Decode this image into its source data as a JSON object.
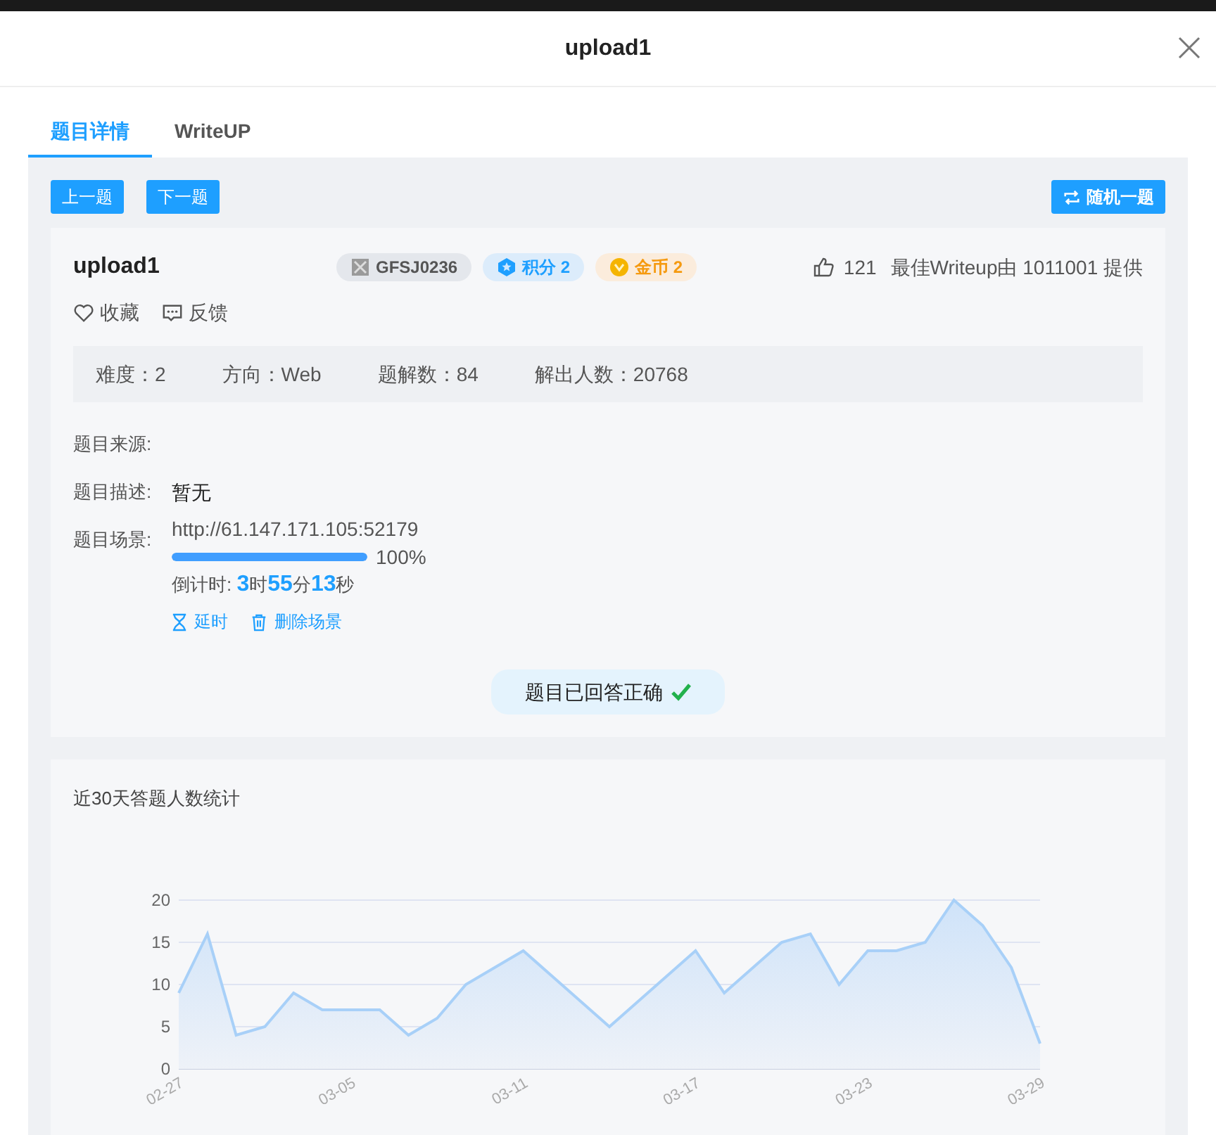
{
  "modal": {
    "title": "upload1"
  },
  "tabs": [
    {
      "label": "题目详情",
      "selected": true
    },
    {
      "label": "WriteUP",
      "selected": false
    }
  ],
  "nav_buttons": {
    "prev": "上一题",
    "next": "下一题",
    "random": "随机一题"
  },
  "challenge": {
    "name": "upload1",
    "badges": [
      {
        "kind": "id",
        "label": "GFSJ0236"
      },
      {
        "kind": "score",
        "label": "积分 2"
      },
      {
        "kind": "coin",
        "label": "金币 2"
      }
    ],
    "likes": "121",
    "best_writeup": "最佳Writeup由 1011001 提供",
    "actions": [
      "收藏",
      "反馈"
    ],
    "stats": [
      "难度：2",
      "方向：Web",
      "题解数：84",
      "解出人数：20768"
    ],
    "source_label": "题目来源:",
    "description_label": "题目描述:",
    "description": "暂无",
    "scene_label": "题目场景:",
    "scene_url": "http://61.147.171.105:52179",
    "scene_progress": {
      "level": 1,
      "reading": "100%"
    },
    "countdown": "倒计时: **3**时**55**分**13**秒",
    "scene_actions": [
      {
        "kind": "extend",
        "label": "延时"
      },
      {
        "kind": "delete",
        "label": "删除场景"
      }
    ],
    "solved": {
      "label": "题目已回答正确",
      "checked": true
    }
  },
  "stats_card": {
    "title": "近30天答题人数统计",
    "chart_data": {
      "type": "area",
      "categories": [
        "02-27",
        null,
        null,
        null,
        null,
        null,
        "03-05",
        null,
        null,
        null,
        null,
        null,
        "03-11",
        null,
        null,
        null,
        null,
        null,
        "03-17",
        null,
        null,
        null,
        null,
        null,
        "03-23",
        null,
        null,
        null,
        null,
        null,
        "03-29"
      ],
      "yticks": [
        0,
        5,
        10,
        15,
        20
      ],
      "ylim": [
        0,
        20
      ],
      "grid": true,
      "series": [
        {
          "color": "#a8d0f8",
          "values": [
            9,
            16,
            4,
            5,
            9,
            7,
            7,
            7,
            4,
            6,
            10,
            12,
            14,
            11,
            8,
            5,
            8,
            11,
            14,
            9,
            12,
            15,
            16,
            10,
            14,
            14,
            15,
            20,
            17,
            12,
            3
          ]
        }
      ]
    }
  }
}
